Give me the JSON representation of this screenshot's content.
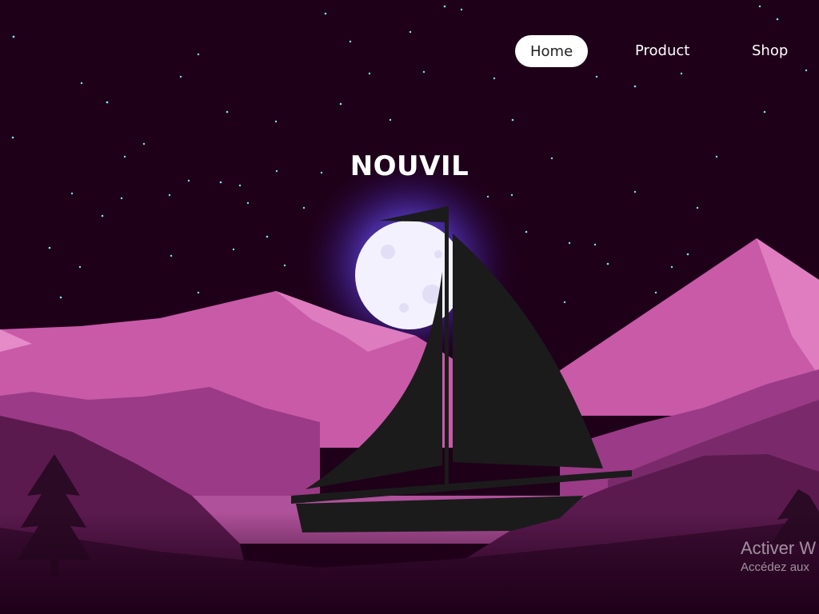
{
  "site": {
    "brand": "NOUVIL"
  },
  "nav": {
    "items": [
      {
        "label": "Home",
        "active": true
      },
      {
        "label": "Product",
        "active": false
      },
      {
        "label": "Shop",
        "active": false
      }
    ]
  },
  "scene": {
    "icons": [
      "moon-icon",
      "sailboat-icon",
      "pine-tree-icon",
      "stars"
    ],
    "colors": {
      "sky": "#1f0019",
      "mountain_light": "#c85aa8",
      "mountain_mid": "#9b3a86",
      "mountain_dark": "#5a1a4e",
      "moon_glow": "#5b3fd9",
      "boat": "#1b1b1b",
      "star": "#7fe3f0"
    }
  },
  "windows_watermark": {
    "title": "Activer W",
    "subtitle": "Accédez aux"
  }
}
